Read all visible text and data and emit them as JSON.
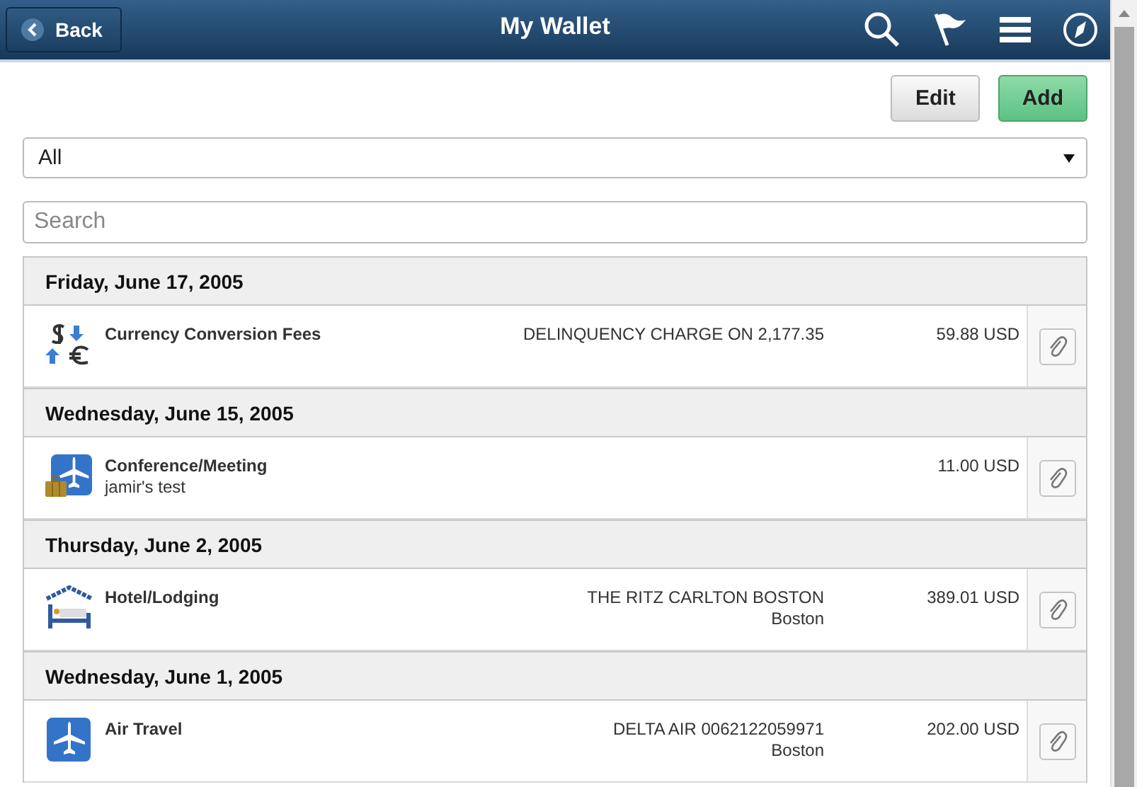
{
  "header": {
    "back": "Back",
    "title": "My Wallet"
  },
  "actions": [
    "Edit",
    "Add"
  ],
  "filter": {
    "value": "All"
  },
  "search": {
    "placeholder": "Search"
  },
  "groups": [
    {
      "date": "Friday, June 17, 2005",
      "entries": [
        {
          "kind": "currency",
          "type": "Currency Conversion Fees",
          "merchant": "DELINQUENCY CHARGE ON 2,177.35",
          "amount": "59.88 USD"
        }
      ]
    },
    {
      "date": "Wednesday, June 15, 2005",
      "entries": [
        {
          "kind": "conference",
          "type": "Conference/Meeting",
          "note": "jamir's test",
          "amount": "11.00 USD"
        }
      ]
    },
    {
      "date": "Thursday, June 2, 2005",
      "entries": [
        {
          "kind": "hotel",
          "type": "Hotel/Lodging",
          "merchant": "THE RITZ CARLTON BOSTON",
          "location": "Boston",
          "amount": "389.01 USD"
        }
      ]
    },
    {
      "date": "Wednesday, June 1, 2005",
      "entries": [
        {
          "kind": "air",
          "type": "Air Travel",
          "merchant": "DELTA AIR 0062122059971",
          "location": "Boston",
          "amount": "202.00 USD"
        }
      ]
    }
  ]
}
